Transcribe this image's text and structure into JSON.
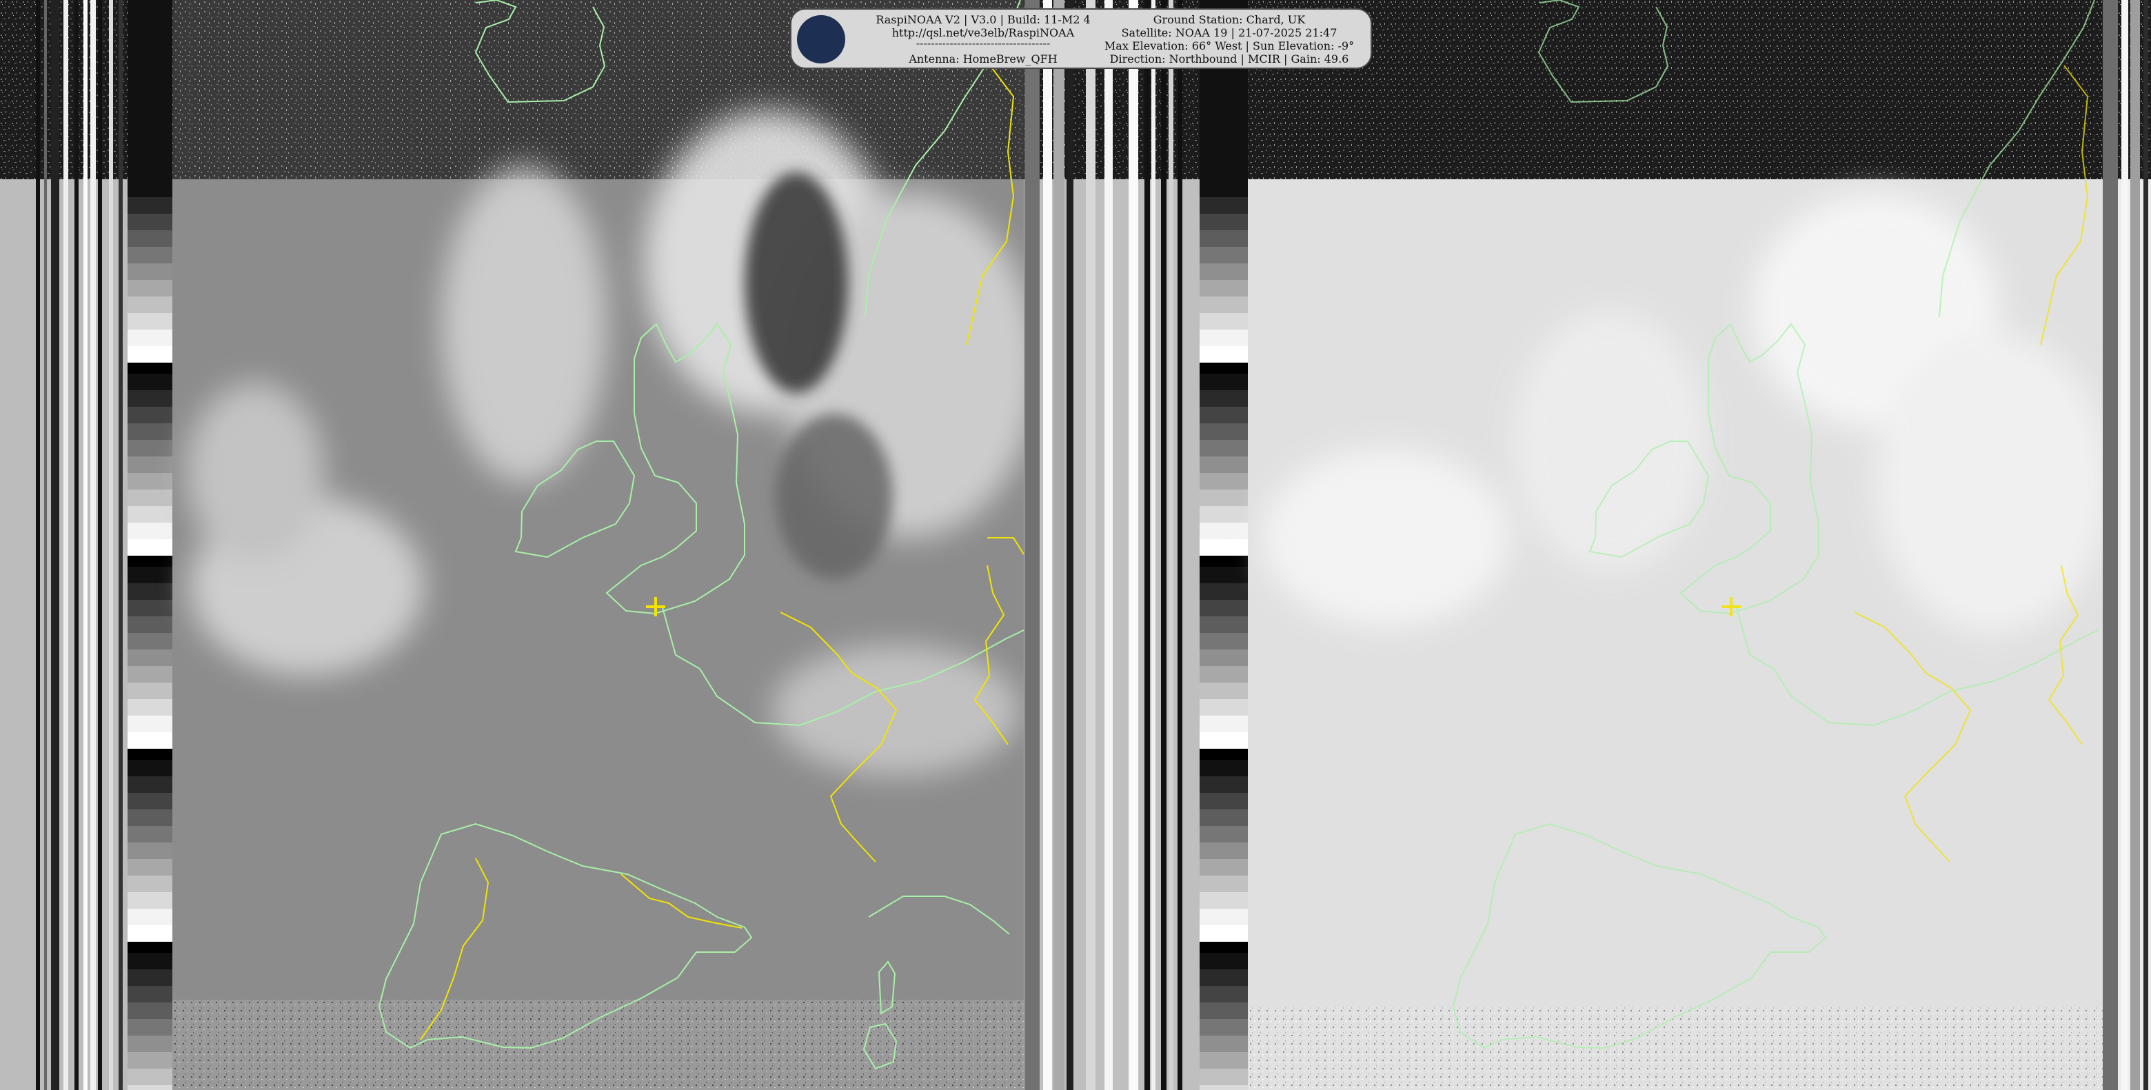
{
  "image_description_hidden": "",
  "info_panel": {
    "line_1": "RaspiNOAA V2 | V3.0 | Build: 11-M2 4",
    "line_2": "http://qsl.net/ve3elb/RaspiNOAA",
    "separator": "------------------------------------",
    "line_3": "Antenna: HomeBrew_QFH",
    "ground_station": "Ground Station: Chard, UK",
    "satellite": "Satellite: NOAA 19 | 21-07-2025 21:47",
    "elevation": "Max Elevation: 66° West | Sun Elevation: -9°",
    "direction": "Direction: Northbound | MCIR | Gain: 49.6"
  },
  "logo": {
    "icon": "satellite-icon",
    "background_color": "#1d2f52",
    "accent_color": "#7cd3e8"
  },
  "image_style": {
    "coastline_color": "#a8f0a8",
    "border_color": "#f2e400",
    "marker_color": "#f2e400",
    "left_panel_tone": "#8c8c8c",
    "right_panel_tone": "#e0e0e0"
  },
  "marker": {
    "icon": "ground-station-cross-icon",
    "label": ""
  }
}
